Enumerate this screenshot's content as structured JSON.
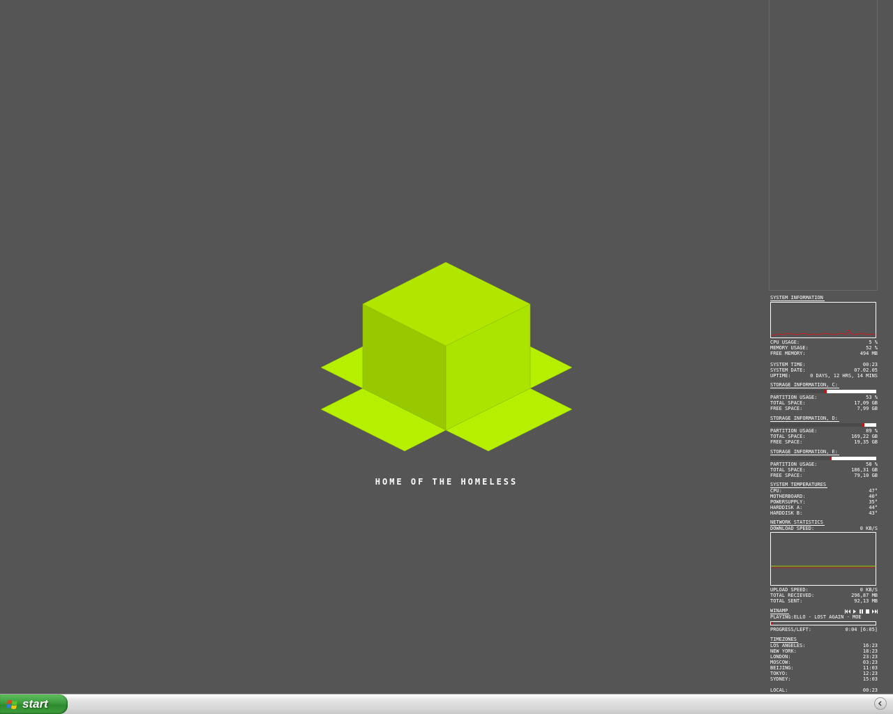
{
  "desktop": {
    "tagline": "HOME OF THE HOMELESS",
    "logo_colors": {
      "top": "#b2e600",
      "left": "#98c800",
      "right": "#aae400",
      "flaps": "#b6f000"
    }
  },
  "sidebar": {
    "system": {
      "title": "SYSTEM INFORMATION",
      "cpu_label": "CPU USAGE:",
      "cpu_value": "5 %",
      "mem_label": "MEMORY USAGE:",
      "mem_value": "52 %",
      "freemem_label": "FREE MEMORY:",
      "freemem_value": "494 MB",
      "time_label": "SYSTEM TIME:",
      "time_value": "00:23",
      "date_label": "SYSTEM DATE:",
      "date_value": "07.02.05",
      "uptime_label": "UPTIME:",
      "uptime_value": "0 DAYS, 12 HRS, 14 MINS"
    },
    "storage_c": {
      "title": "STORAGE INFORMATION, C:",
      "usage_fraction": 0.53,
      "usage_label": "PARTITION USAGE:",
      "usage_value": "53 %",
      "total_label": "TOTAL SPACE:",
      "total_value": "17,09 GB",
      "free_label": "FREE SPACE:",
      "free_value": "7,99 GB"
    },
    "storage_d": {
      "title": "STORAGE INFORMATION, D:",
      "usage_fraction": 0.89,
      "usage_label": "PARTITION USAGE:",
      "usage_value": "89 %",
      "total_label": "TOTAL SPACE:",
      "total_value": "169,22 GB",
      "free_label": "FREE SPACE:",
      "free_value": "19,35 GB"
    },
    "storage_e": {
      "title": "STORAGE INFORMATION, E:",
      "usage_fraction": 0.58,
      "usage_label": "PARTITION USAGE:",
      "usage_value": "58 %",
      "total_label": "TOTAL SPACE:",
      "total_value": "186,31 GB",
      "free_label": "FREE SPACE:",
      "free_value": "79,10 GB"
    },
    "temps": {
      "title": "SYSTEM TEMPERATURES",
      "rows": [
        {
          "label": "CPU:",
          "value": "47°"
        },
        {
          "label": "MOTHERBOARD:",
          "value": "40°"
        },
        {
          "label": "POWERSUPPLY:",
          "value": "35°"
        },
        {
          "label": "HARDDISK A:",
          "value": "44°"
        },
        {
          "label": "HARDDISK B:",
          "value": "43°"
        }
      ]
    },
    "network": {
      "title": "NETWORK STATISTICS",
      "down_label": "DOWNLOAD SPEED:",
      "down_value": "0 KB/S",
      "up_label": "UPLOAD SPEED:",
      "up_value": "0 KB/S",
      "recv_label": "TOTAL RECIEVED:",
      "recv_value": "296,87 MB",
      "sent_label": "TOTAL SENT:",
      "sent_value": "92,13 MB"
    },
    "winamp": {
      "title": "WINAMP",
      "playing": "PLAYING:ELLO - LOST AGAIN - MOE",
      "progress_label": "PROGRESS/LEFT:",
      "progress_value": "0:04 [6:05]",
      "progress_fraction": 0.01
    },
    "timezones": {
      "title": "TIMEZONES",
      "rows": [
        {
          "label": "LOS ANGELES:",
          "value": "16:23"
        },
        {
          "label": "NEW YORK:",
          "value": "18:23"
        },
        {
          "label": "LONDON:",
          "value": "23:23"
        },
        {
          "label": "MOSCOW:",
          "value": "03:23"
        },
        {
          "label": "BEIJING:",
          "value": "11:03"
        },
        {
          "label": "TOKYO:",
          "value": "12:23"
        },
        {
          "label": "SYDNEY:",
          "value": "15:03"
        }
      ],
      "local_label": "LOCAL:",
      "local_value": "00:23"
    }
  },
  "taskbar": {
    "start_label": "start"
  }
}
